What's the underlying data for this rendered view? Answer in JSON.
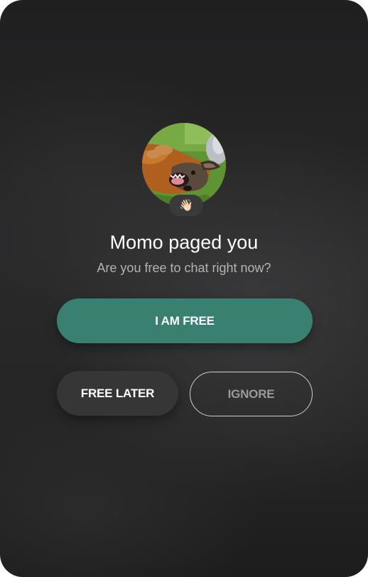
{
  "notification": {
    "avatar_alt": "Momo profile photo",
    "badge_emoji": "👋🏻",
    "title": "Momo paged you",
    "subtitle": "Are you free to chat right now?"
  },
  "actions": {
    "primary_label": "I AM FREE",
    "later_label": "FREE LATER",
    "ignore_label": "IGNORE"
  },
  "icons": {
    "badge": "waving-hand-icon"
  },
  "colors": {
    "primary_button": "#3a8070",
    "secondary_button": "#363637",
    "ignore_border": "#cfcfcf",
    "background": "#282829"
  }
}
